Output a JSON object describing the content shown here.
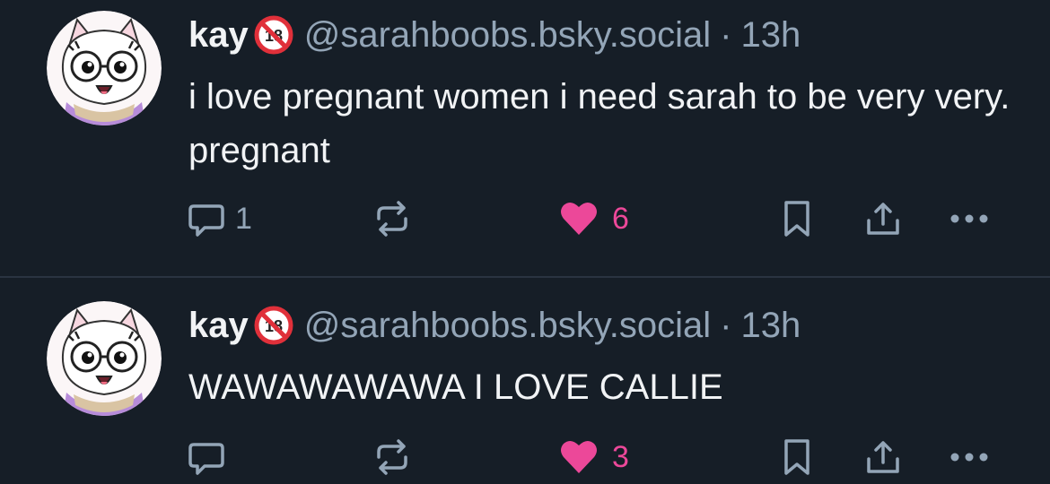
{
  "posts": [
    {
      "author": {
        "display_name": "kay",
        "badge_icon": "no-under-18-icon",
        "handle": "@sarahboobs.bsky.social"
      },
      "separator": "·",
      "time": "13h",
      "text": "i love pregnant women i need sarah to be very very. pregnant",
      "actions": {
        "reply_count": "1",
        "repost_count": "",
        "like_count": "6",
        "liked": true
      }
    },
    {
      "author": {
        "display_name": "kay",
        "badge_icon": "no-under-18-icon",
        "handle": "@sarahboobs.bsky.social"
      },
      "separator": "·",
      "time": "13h",
      "text": "WAWAWAWAWA I LOVE CALLIE",
      "actions": {
        "reply_count": "",
        "repost_count": "",
        "like_count": "3",
        "liked": true
      }
    }
  ],
  "colors": {
    "background": "#161e27",
    "text": "#f1f3f5",
    "muted": "#93a5b7",
    "like": "#ec4899",
    "badge_red": "#e0303a"
  }
}
